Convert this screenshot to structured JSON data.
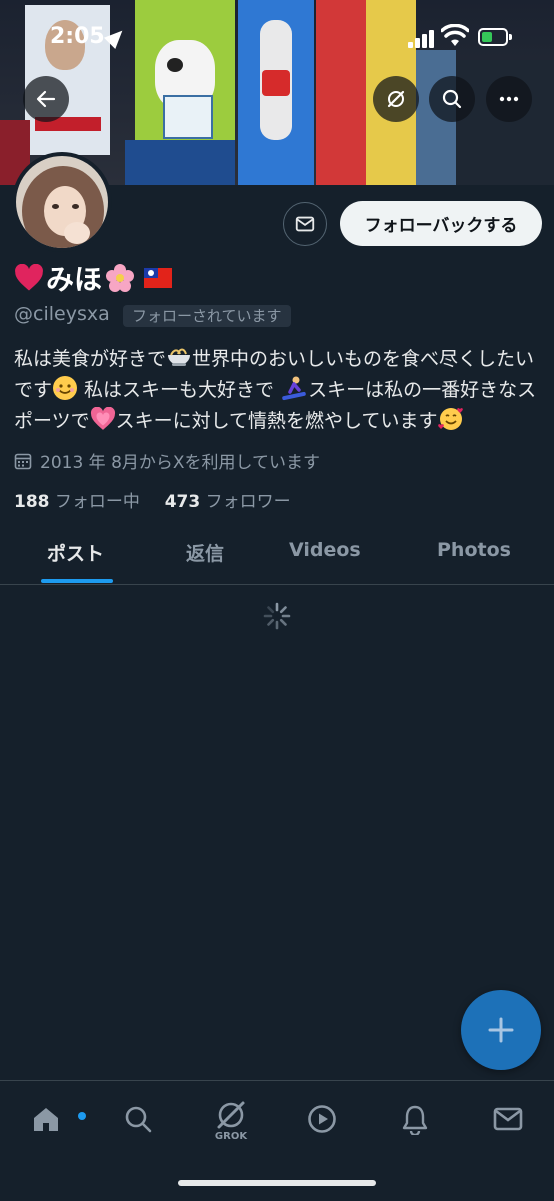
{
  "status_bar": {
    "time": "2:05"
  },
  "profile": {
    "name": "みほ",
    "handle": "@cileysxa",
    "follows_you_badge": "フォローされています",
    "bio_parts": [
      "私は美食が好きで",
      "世界中のおいしいものを食べ尽くしたいです",
      " 私はスキーも大好きで",
      "スキーは私の一番好きなスポーツで",
      "スキーに対して情熱を燃やしています"
    ],
    "joined": "2013 年 8月からXを利用しています",
    "following_count": "188",
    "following_label": "フォロー中",
    "followers_count": "473",
    "followers_label": "フォロワー"
  },
  "actions": {
    "follow_back": "フォローバックする"
  },
  "tabs": [
    {
      "label": "ポスト",
      "active": true
    },
    {
      "label": "返信",
      "active": false
    },
    {
      "label": "Videos",
      "active": false
    },
    {
      "label": "Photos",
      "active": false
    }
  ],
  "bottom_nav": {
    "items": [
      "home-icon",
      "search-icon",
      "grok-icon",
      "video-icon",
      "notifications-icon",
      "messages-icon"
    ],
    "grok_label": "GROK"
  },
  "colors": {
    "background": "#15202b",
    "accent": "#1d9bf0",
    "fab": "#1d71b8"
  }
}
